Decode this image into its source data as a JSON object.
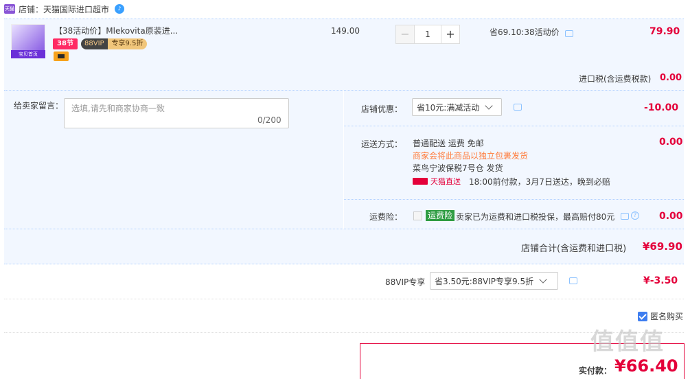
{
  "shop": {
    "logo_text": "天猫国际",
    "label": "店铺：天猫国际进口超市"
  },
  "item": {
    "thumb_tag": "宝贝首页",
    "title": "【38活动价】Mlekovita原装进...",
    "tag_38": "38节",
    "vip_a": "88VIP",
    "vip_b": "专享9.5折",
    "unit_price": "149.00",
    "quantity": "1",
    "minus": "−",
    "plus": "+",
    "save_text": "省69.10:38活动价",
    "subtotal": "79.90"
  },
  "tax": {
    "label": "进口税(含运费税款)",
    "value": "0.00"
  },
  "message": {
    "label": "给卖家留言：",
    "placeholder": "选填,请先和商家协商一致",
    "count": "0/200"
  },
  "discount": {
    "label": "店铺优惠：",
    "selected": "省10元:满减活动",
    "value": "-10.00"
  },
  "shipping": {
    "label": "运送方式：",
    "line1": "普通配送 运费 免邮",
    "line2": "商家会将此商品以独立包裹发货",
    "line3": "菜鸟宁波保税7号仓  发货",
    "tmall": "天猫直送",
    "eta": "18:00前付款，3月7日送达，晚到必赔",
    "value": "0.00"
  },
  "insurance": {
    "label": "运费险：",
    "tag": "运费险",
    "text": "卖家已为运费和进口税投保，最高赔付80元",
    "value": "0.00"
  },
  "store_total": {
    "label": "店铺合计(含运费和进口税)",
    "value": "¥69.90"
  },
  "vip": {
    "label": "88VIP专享",
    "selected": "省3.50元:88VIP专享9.5折",
    "value": "¥-3.50"
  },
  "anonymous": {
    "label": "匿名购买"
  },
  "payment": {
    "label": "实付款：",
    "value": "¥66.40"
  },
  "watermark": "值值值",
  "colors": {
    "accent": "#e4003a",
    "panel": "#f2f7ff",
    "checkbox": "#3d7df0"
  }
}
